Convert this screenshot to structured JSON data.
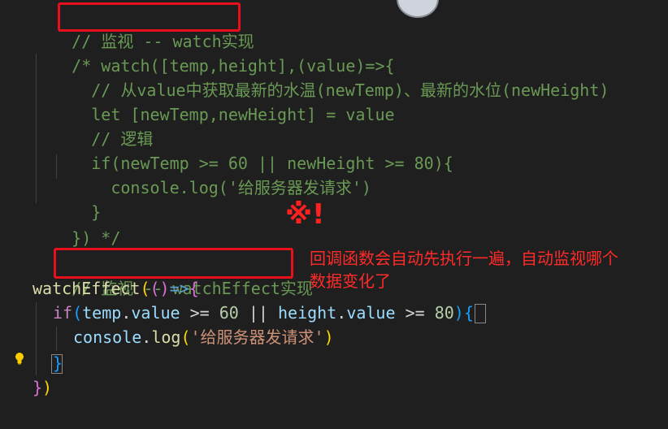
{
  "code": {
    "l1": {
      "comment": "// 监视 -- watch实现"
    },
    "l2": {
      "comment": "/* watch([temp,height],(value)=>{"
    },
    "l3": {
      "comment": "  // 从value中获取最新的水温(newTemp)、最新的水位(newHeight)"
    },
    "l4": {
      "comment": "  let [newTemp,newHeight] = value"
    },
    "l5": {
      "comment": "  // 逻辑"
    },
    "l6": {
      "comment": "  if(newTemp >= 60 || newHeight >= 80){"
    },
    "l7": {
      "comment": "    console.log('给服务器发请求')"
    },
    "l8": {
      "comment": "  }"
    },
    "l9": {
      "comment": "}) */"
    },
    "l10": {
      "comment": "// 监视 -- watchEffect实现"
    },
    "l11": {
      "fn": "watchEffect",
      "open": "(",
      "paren2": "()",
      "arrow": "=>",
      "brace": "{"
    },
    "l12": {
      "kw": "if",
      "p_open": "(",
      "v1": "temp",
      "dot1": ".",
      "v1b": "value",
      "op1": " >= ",
      "n1": "60",
      "op2": " || ",
      "v2": "height",
      "dot2": ".",
      "v2b": "value",
      "op3": " >= ",
      "n2": "80",
      "p_close": ")",
      "brace": "{"
    },
    "l13": {
      "v": "console",
      "dot": ".",
      "fn": "log",
      "p_open": "(",
      "str": "'给服务器发请求'",
      "p_close": ")"
    },
    "l14": {
      "brace": "}"
    },
    "l15": {
      "brace": "}",
      "paren": ")"
    }
  },
  "annotations": {
    "mark": "※!",
    "note_line1": "回调函数会自动先执行一遍，自动监视哪个",
    "note_line2": "数据变化了"
  },
  "icons": {
    "lightbulb": "lightbulb-icon"
  }
}
